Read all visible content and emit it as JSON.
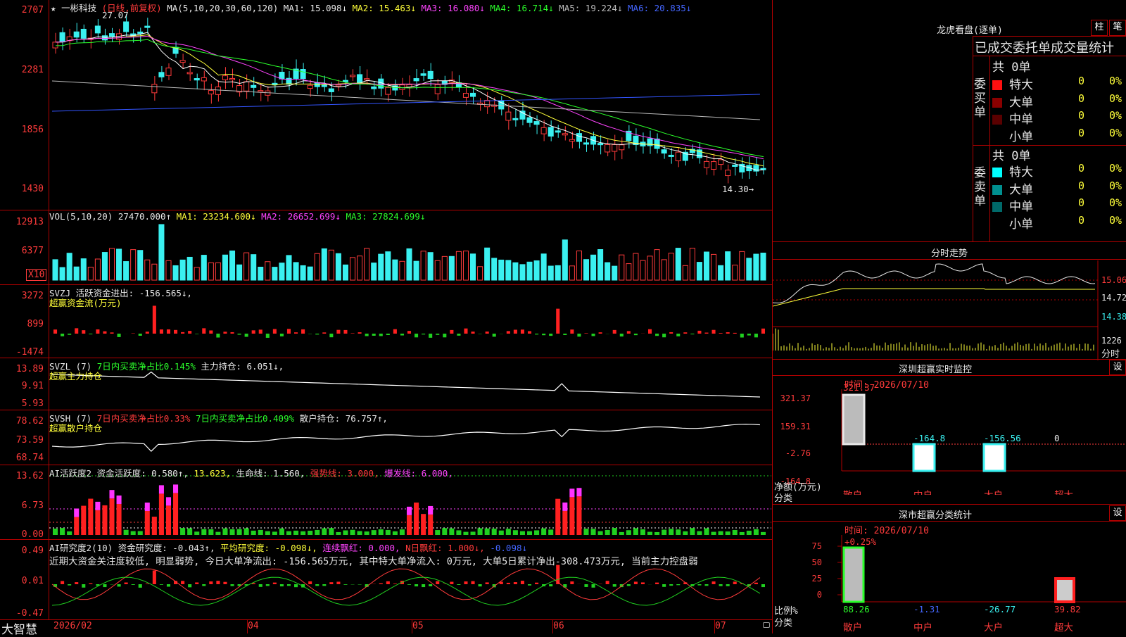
{
  "main": {
    "title_prefix": "★",
    "stock_name": "一彬科技",
    "period": "(日线,前复权)",
    "ma_params": "MA(5,10,20,30,60,120)",
    "ma1": "MA1: 15.098↓",
    "ma2": "MA2: 15.463↓",
    "ma3": "MA3: 16.080↓",
    "ma4": "MA4: 16.714↓",
    "ma5": "MA5: 19.224↓",
    "ma6": "MA6: 20.835↓",
    "high_mark": "27.07",
    "low_mark": "14.30→",
    "y_ticks": [
      "2707",
      "2281",
      "1856",
      "1430"
    ]
  },
  "vol": {
    "label": "VOL(5,10,20)",
    "value": "27470.000↑",
    "ma1": "MA1: 23234.600↓",
    "ma2": "MA2: 26652.699↓",
    "ma3": "MA3: 27824.699↓",
    "y_ticks": [
      "12913",
      "6377"
    ],
    "unit_badge": "X10"
  },
  "svzj": {
    "label": "SVZJ",
    "text": "活跃资金进出: -156.565↓,",
    "sub": "超赢资金流(万元)",
    "y_ticks": [
      "3272",
      "899",
      "-1474"
    ]
  },
  "svzl": {
    "label": "SVZL (7)",
    "t1": "7日内买卖净占比0.145%",
    "t2": "主力持仓: 6.051↓,",
    "sub": "超赢主力持仓",
    "y_ticks": [
      "13.89",
      "9.91",
      "5.93"
    ]
  },
  "svsh": {
    "label": "SVSH (7)",
    "t1": "7日内买卖净占比0.33%",
    "t2": "7日内买卖净占比0.409%",
    "t3": "散户持仓: 76.757↑,",
    "sub": "超赢散户持仓",
    "y_ticks": [
      "78.62",
      "73.59",
      "68.74"
    ]
  },
  "ai1": {
    "label": "AI活跃度2",
    "t1": "资金活跃度: 0.580↑,",
    "t2": "13.623,",
    "t3": "生命线: 1.560,",
    "t4": "强势线: 3.000,",
    "t5": "爆发线: 6.000,",
    "y_ticks": [
      "13.62",
      "6.73",
      "0.00"
    ]
  },
  "ai2": {
    "label": "AI研究度2(10)",
    "t1": "资金研究度: -0.043↑,",
    "t2": "平均研究度: -0.098↓,",
    "t3": "连续飘红: 0.000,",
    "t4": "N日飘红: 1.000↓,",
    "t5": "-0.098↓",
    "summary": "近期大资金关注度较低, 明显弱势, 今日大单净流出: -156.565万元, 其中特大单净流入: 0万元, 大单5日累计净出-308.473万元, 当前主力控盘弱",
    "y_ticks": [
      "0.49",
      "0.01",
      "-0.47"
    ]
  },
  "bottom_axis": {
    "brand": "大智慧",
    "dates": [
      "2026/02",
      "04",
      "05",
      "06",
      "07"
    ]
  },
  "right": {
    "lhkp_title": "龙虎看盘(逐单)",
    "btn_zhu": "柱",
    "btn_bi": "笔",
    "stat_title": "已成交委托单成交量统计",
    "buy_label": "委买单",
    "sell_label": "委卖单",
    "buy_total": "共 0单",
    "sell_total": "共 0单",
    "buy_rows": [
      {
        "name": "特大",
        "count": "0",
        "pct": "0%",
        "color": "#ff1010"
      },
      {
        "name": "大单",
        "count": "0",
        "pct": "0%",
        "color": "#8b0000"
      },
      {
        "name": "中单",
        "count": "0",
        "pct": "0%",
        "color": "#5a0000"
      },
      {
        "name": "小单",
        "count": "0",
        "pct": "0%",
        "color": "#000000"
      }
    ],
    "sell_rows": [
      {
        "name": "特大",
        "count": "0",
        "pct": "0%",
        "color": "#00ffff"
      },
      {
        "name": "大单",
        "count": "0",
        "pct": "0%",
        "color": "#009090"
      },
      {
        "name": "中单",
        "count": "0",
        "pct": "0%",
        "color": "#006a6a"
      },
      {
        "name": "小单",
        "count": "0",
        "pct": "0%",
        "color": "#000000"
      }
    ],
    "fs_title": "分时走势",
    "fs_y": [
      "15.06",
      "14.72",
      "14.38"
    ],
    "fs_vol": "1226",
    "fs_label": "分时",
    "mon_title": "深圳超赢实时监控",
    "mon_btn": "设",
    "mon_time": "时间: 2026/07/10",
    "mon_y": [
      "321.37",
      "159.31",
      "-2.76",
      "-164.8"
    ],
    "mon_vals": [
      "321.37",
      "-164.8",
      "-156.56",
      "0"
    ],
    "mon_unit": "净额(万元)",
    "mon_cat": "分类",
    "mon_x": [
      "散户",
      "中户",
      "大户",
      "超大"
    ],
    "cls_title": "深市超赢分类统计",
    "cls_btn": "设",
    "cls_time": "时间: 2026/07/10",
    "cls_top": "+0.25%",
    "cls_y": [
      "75",
      "50",
      "25",
      "0"
    ],
    "cls_unit": "比例%",
    "cls_cat": "分类",
    "cls_vals": [
      "88.26",
      "-1.31",
      "-26.77",
      "39.82"
    ],
    "cls_x": [
      "散户",
      "中户",
      "大户",
      "超大"
    ]
  }
}
